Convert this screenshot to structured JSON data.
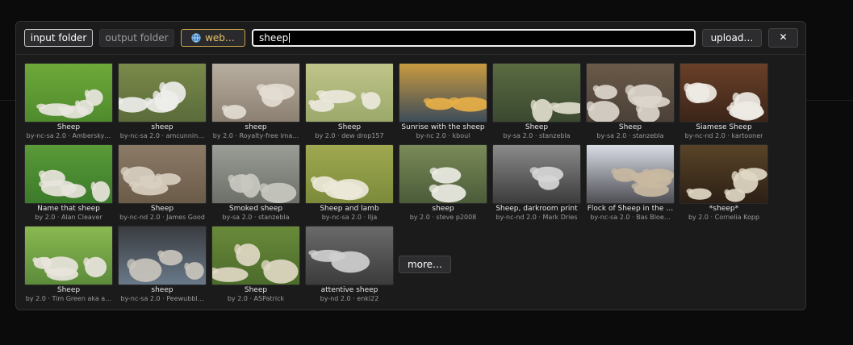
{
  "toolbar": {
    "input_folder": "input folder",
    "output_folder": "output folder",
    "web": "web…",
    "search_value": "sheep",
    "upload": "upload…",
    "close": "✕"
  },
  "results": [
    {
      "title": "Sheep",
      "license": "by-nc-sa 2.0 · Ambersky…",
      "palette": [
        "#4e8a2c",
        "#6ea83a",
        "#e8e6de"
      ]
    },
    {
      "title": "sheep",
      "license": "by-nc-sa 2.0 · amcunnin…",
      "palette": [
        "#5a6a3a",
        "#7a8a4a",
        "#eeeeea"
      ]
    },
    {
      "title": "sheep",
      "license": "by 2.0 · Royalty-free ima…",
      "palette": [
        "#8a7e70",
        "#b8aea0",
        "#e2dcd2"
      ]
    },
    {
      "title": "Sheep",
      "license": "by 2.0 · dew drop157",
      "palette": [
        "#9aa86a",
        "#c0c48a",
        "#ece8dc"
      ]
    },
    {
      "title": "Sunrise with the sheep",
      "license": "by-nc 2.0 · kboul",
      "palette": [
        "#3a4a5a",
        "#c89a40",
        "#e8b048"
      ]
    },
    {
      "title": "Sheep",
      "license": "by-sa 2.0 · stanzebla",
      "palette": [
        "#3a4830",
        "#5a6a40",
        "#e0dccc"
      ]
    },
    {
      "title": "Sheep",
      "license": "by-sa 2.0 · stanzebla",
      "palette": [
        "#4a4038",
        "#6a5a48",
        "#dcd6cc"
      ]
    },
    {
      "title": "Siamese Sheep",
      "license": "by-nc-nd 2.0 · kartooner",
      "palette": [
        "#3a2418",
        "#6a4028",
        "#eeeae4"
      ]
    },
    {
      "title": "Name that sheep",
      "license": "by 2.0 · Alan Cleaver",
      "palette": [
        "#3a7a2a",
        "#5a9a38",
        "#e8e4dc"
      ]
    },
    {
      "title": "Sheep",
      "license": "by-nc-nd 2.0 · James Good",
      "palette": [
        "#6a5a48",
        "#8a7a66",
        "#d8cfc0"
      ]
    },
    {
      "title": "Smoked sheep",
      "license": "by-sa 2.0 · stanzebla",
      "palette": [
        "#6a6e66",
        "#9a9e96",
        "#c8c8c0"
      ]
    },
    {
      "title": "Sheep and lamb",
      "license": "by-nc-sa 2.0 · Ilja",
      "palette": [
        "#7a8a3a",
        "#a0a850",
        "#ece8d8"
      ]
    },
    {
      "title": "sheep",
      "license": "by 2.0 · steve p2008",
      "palette": [
        "#4a5a38",
        "#7a8a58",
        "#ecece4"
      ]
    },
    {
      "title": "Sheep, darkroom print",
      "license": "by-nc-nd 2.0 · Mark Dries",
      "palette": [
        "#3a3a3a",
        "#8a8a8a",
        "#d6d6d6"
      ]
    },
    {
      "title": "Flock of Sheep in the …",
      "license": "by-nc-sa 2.0 · Bas Bloe…",
      "palette": [
        "#4a4a50",
        "#d8dce4",
        "#c8b8a0"
      ]
    },
    {
      "title": "*sheep*",
      "license": "by 2.0 · Cornelia Kopp",
      "palette": [
        "#2a1e14",
        "#5a4428",
        "#e0d8c4"
      ]
    },
    {
      "title": "Sheep",
      "license": "by 2.0 · Tim Green aka a…",
      "palette": [
        "#5a8a3a",
        "#8ab850",
        "#e8e4dc"
      ]
    },
    {
      "title": "sheep",
      "license": "by-nc-sa 2.0 · Peewubbl…",
      "palette": [
        "#6a7a8a",
        "#3a3c40",
        "#c8c4bc"
      ]
    },
    {
      "title": "Sheep",
      "license": "by 2.0 · ASPatrick",
      "palette": [
        "#4a6a2a",
        "#6a8a3a",
        "#e0d8c4"
      ]
    },
    {
      "title": "attentive sheep",
      "license": "by-nd 2.0 · enki22",
      "palette": [
        "#3a3a3a",
        "#6a6a6a",
        "#cfcfcf"
      ]
    }
  ],
  "more_label": "more…"
}
